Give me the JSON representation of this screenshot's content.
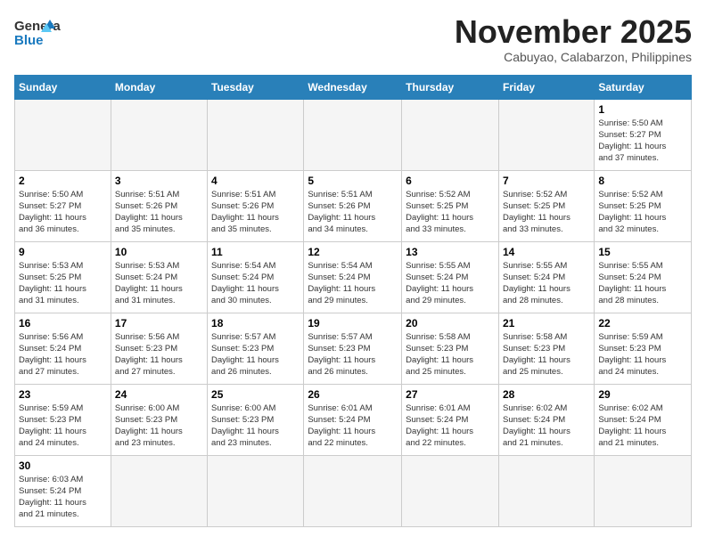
{
  "logo": {
    "line1": "General",
    "line2": "Blue"
  },
  "title": "November 2025",
  "location": "Cabuyao, Calabarzon, Philippines",
  "weekdays": [
    "Sunday",
    "Monday",
    "Tuesday",
    "Wednesday",
    "Thursday",
    "Friday",
    "Saturday"
  ],
  "days": [
    {
      "num": "",
      "info": "",
      "empty": true
    },
    {
      "num": "",
      "info": "",
      "empty": true
    },
    {
      "num": "",
      "info": "",
      "empty": true
    },
    {
      "num": "",
      "info": "",
      "empty": true
    },
    {
      "num": "",
      "info": "",
      "empty": true
    },
    {
      "num": "",
      "info": "",
      "empty": true
    },
    {
      "num": "1",
      "info": "Sunrise: 5:50 AM\nSunset: 5:27 PM\nDaylight: 11 hours\nand 37 minutes."
    },
    {
      "num": "2",
      "info": "Sunrise: 5:50 AM\nSunset: 5:27 PM\nDaylight: 11 hours\nand 36 minutes."
    },
    {
      "num": "3",
      "info": "Sunrise: 5:51 AM\nSunset: 5:26 PM\nDaylight: 11 hours\nand 35 minutes."
    },
    {
      "num": "4",
      "info": "Sunrise: 5:51 AM\nSunset: 5:26 PM\nDaylight: 11 hours\nand 35 minutes."
    },
    {
      "num": "5",
      "info": "Sunrise: 5:51 AM\nSunset: 5:26 PM\nDaylight: 11 hours\nand 34 minutes."
    },
    {
      "num": "6",
      "info": "Sunrise: 5:52 AM\nSunset: 5:25 PM\nDaylight: 11 hours\nand 33 minutes."
    },
    {
      "num": "7",
      "info": "Sunrise: 5:52 AM\nSunset: 5:25 PM\nDaylight: 11 hours\nand 33 minutes."
    },
    {
      "num": "8",
      "info": "Sunrise: 5:52 AM\nSunset: 5:25 PM\nDaylight: 11 hours\nand 32 minutes."
    },
    {
      "num": "9",
      "info": "Sunrise: 5:53 AM\nSunset: 5:25 PM\nDaylight: 11 hours\nand 31 minutes."
    },
    {
      "num": "10",
      "info": "Sunrise: 5:53 AM\nSunset: 5:24 PM\nDaylight: 11 hours\nand 31 minutes."
    },
    {
      "num": "11",
      "info": "Sunrise: 5:54 AM\nSunset: 5:24 PM\nDaylight: 11 hours\nand 30 minutes."
    },
    {
      "num": "12",
      "info": "Sunrise: 5:54 AM\nSunset: 5:24 PM\nDaylight: 11 hours\nand 29 minutes."
    },
    {
      "num": "13",
      "info": "Sunrise: 5:55 AM\nSunset: 5:24 PM\nDaylight: 11 hours\nand 29 minutes."
    },
    {
      "num": "14",
      "info": "Sunrise: 5:55 AM\nSunset: 5:24 PM\nDaylight: 11 hours\nand 28 minutes."
    },
    {
      "num": "15",
      "info": "Sunrise: 5:55 AM\nSunset: 5:24 PM\nDaylight: 11 hours\nand 28 minutes."
    },
    {
      "num": "16",
      "info": "Sunrise: 5:56 AM\nSunset: 5:24 PM\nDaylight: 11 hours\nand 27 minutes."
    },
    {
      "num": "17",
      "info": "Sunrise: 5:56 AM\nSunset: 5:23 PM\nDaylight: 11 hours\nand 27 minutes."
    },
    {
      "num": "18",
      "info": "Sunrise: 5:57 AM\nSunset: 5:23 PM\nDaylight: 11 hours\nand 26 minutes."
    },
    {
      "num": "19",
      "info": "Sunrise: 5:57 AM\nSunset: 5:23 PM\nDaylight: 11 hours\nand 26 minutes."
    },
    {
      "num": "20",
      "info": "Sunrise: 5:58 AM\nSunset: 5:23 PM\nDaylight: 11 hours\nand 25 minutes."
    },
    {
      "num": "21",
      "info": "Sunrise: 5:58 AM\nSunset: 5:23 PM\nDaylight: 11 hours\nand 25 minutes."
    },
    {
      "num": "22",
      "info": "Sunrise: 5:59 AM\nSunset: 5:23 PM\nDaylight: 11 hours\nand 24 minutes."
    },
    {
      "num": "23",
      "info": "Sunrise: 5:59 AM\nSunset: 5:23 PM\nDaylight: 11 hours\nand 24 minutes."
    },
    {
      "num": "24",
      "info": "Sunrise: 6:00 AM\nSunset: 5:23 PM\nDaylight: 11 hours\nand 23 minutes."
    },
    {
      "num": "25",
      "info": "Sunrise: 6:00 AM\nSunset: 5:23 PM\nDaylight: 11 hours\nand 23 minutes."
    },
    {
      "num": "26",
      "info": "Sunrise: 6:01 AM\nSunset: 5:24 PM\nDaylight: 11 hours\nand 22 minutes."
    },
    {
      "num": "27",
      "info": "Sunrise: 6:01 AM\nSunset: 5:24 PM\nDaylight: 11 hours\nand 22 minutes."
    },
    {
      "num": "28",
      "info": "Sunrise: 6:02 AM\nSunset: 5:24 PM\nDaylight: 11 hours\nand 21 minutes."
    },
    {
      "num": "29",
      "info": "Sunrise: 6:02 AM\nSunset: 5:24 PM\nDaylight: 11 hours\nand 21 minutes."
    },
    {
      "num": "30",
      "info": "Sunrise: 6:03 AM\nSunset: 5:24 PM\nDaylight: 11 hours\nand 21 minutes."
    },
    {
      "num": "",
      "info": "",
      "empty": true
    },
    {
      "num": "",
      "info": "",
      "empty": true
    },
    {
      "num": "",
      "info": "",
      "empty": true
    },
    {
      "num": "",
      "info": "",
      "empty": true
    },
    {
      "num": "",
      "info": "",
      "empty": true
    },
    {
      "num": "",
      "info": "",
      "empty": true
    }
  ]
}
